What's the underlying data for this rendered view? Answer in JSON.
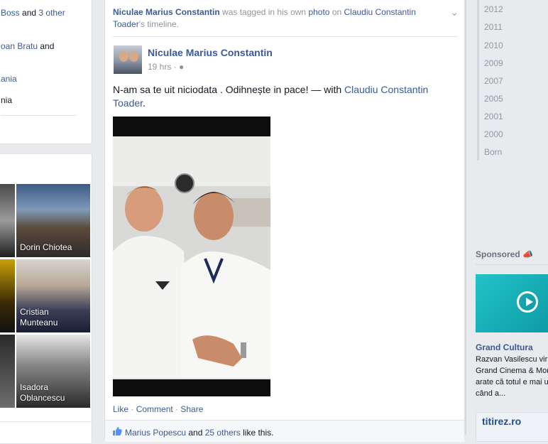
{
  "left": {
    "top_lines": [
      {
        "a": "Boss",
        "b": " and ",
        "c": "3 other"
      },
      {
        "a": "oan Bratu",
        "b": " and",
        "c": ""
      },
      {
        "a": "ania",
        "b": "",
        "c": ""
      },
      {
        "a": "",
        "b": "nia",
        "c": ""
      }
    ],
    "friends": [
      {
        "name": "Dorin Chiotea"
      },
      {
        "name": "Cristian Munteanu"
      },
      {
        "name": "Isadora Oblancescu"
      }
    ]
  },
  "post": {
    "header": {
      "actor": "Niculae Marius Constantin",
      "text1": " was tagged in his own ",
      "photo_link": "photo",
      "text2": " on ",
      "target": "Claudiu Constantin Toader",
      "text3": "'s timeline."
    },
    "author": "Niculae Marius Constantin",
    "time": "19 hrs",
    "separator": " · ",
    "text": "N-am sa te uit niciodata . Odihnește in pace! — with ",
    "tagged": "Claudiu Constantin Toader",
    "text_end": ".",
    "actions": {
      "like": "Like",
      "comment": "Comment",
      "share": "Share",
      "dot": " · "
    },
    "likes": {
      "name": "Marius Popescu",
      "and": " and ",
      "others": "25 others",
      "tail": " like this."
    }
  },
  "right": {
    "years": [
      "2012",
      "2011",
      "2010",
      "2009",
      "2007",
      "2005",
      "2001",
      "2000",
      "Born"
    ],
    "sponsored_label": "Sponsored",
    "ad": {
      "title": "Grand Cultura",
      "body": "Razvan Vasilescu vir\nGrand Cinema & More\narate că totul e mai us\ncând a..."
    },
    "ad2_logo": "titirez.ro"
  },
  "colors": {
    "brand": "#3b5998",
    "meta": "#90949c",
    "teal": "#1ab6be"
  }
}
